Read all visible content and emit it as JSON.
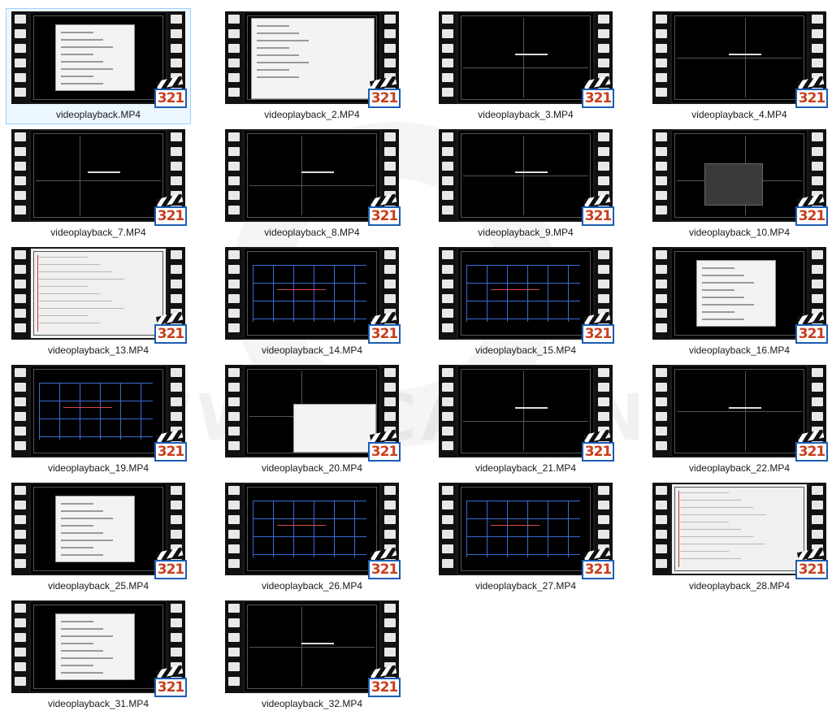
{
  "badge_text": "321",
  "watermark": "WWW.CADONLINE.VN",
  "files": [
    {
      "name": "videoplayback.MP4",
      "selected": true,
      "style": "dialog"
    },
    {
      "name": "videoplayback_2.MP4",
      "selected": false,
      "style": "dialog2"
    },
    {
      "name": "videoplayback_3.MP4",
      "selected": false,
      "style": "cad"
    },
    {
      "name": "videoplayback_4.MP4",
      "selected": false,
      "style": "cad"
    },
    {
      "name": "videoplayback_7.MP4",
      "selected": false,
      "style": "cad"
    },
    {
      "name": "videoplayback_8.MP4",
      "selected": false,
      "style": "cad"
    },
    {
      "name": "videoplayback_9.MP4",
      "selected": false,
      "style": "cad"
    },
    {
      "name": "videoplayback_10.MP4",
      "selected": false,
      "style": "cadpanel"
    },
    {
      "name": "videoplayback_13.MP4",
      "selected": false,
      "style": "light"
    },
    {
      "name": "videoplayback_14.MP4",
      "selected": false,
      "style": "plan"
    },
    {
      "name": "videoplayback_15.MP4",
      "selected": false,
      "style": "plan"
    },
    {
      "name": "videoplayback_16.MP4",
      "selected": false,
      "style": "dialog"
    },
    {
      "name": "videoplayback_19.MP4",
      "selected": false,
      "style": "plan"
    },
    {
      "name": "videoplayback_20.MP4",
      "selected": false,
      "style": "cadpopup"
    },
    {
      "name": "videoplayback_21.MP4",
      "selected": false,
      "style": "cad"
    },
    {
      "name": "videoplayback_22.MP4",
      "selected": false,
      "style": "cad"
    },
    {
      "name": "videoplayback_25.MP4",
      "selected": false,
      "style": "dialog"
    },
    {
      "name": "videoplayback_26.MP4",
      "selected": false,
      "style": "plan"
    },
    {
      "name": "videoplayback_27.MP4",
      "selected": false,
      "style": "plan"
    },
    {
      "name": "videoplayback_28.MP4",
      "selected": false,
      "style": "light"
    },
    {
      "name": "videoplayback_31.MP4",
      "selected": false,
      "style": "dialog"
    },
    {
      "name": "videoplayback_32.MP4",
      "selected": false,
      "style": "cad"
    }
  ]
}
